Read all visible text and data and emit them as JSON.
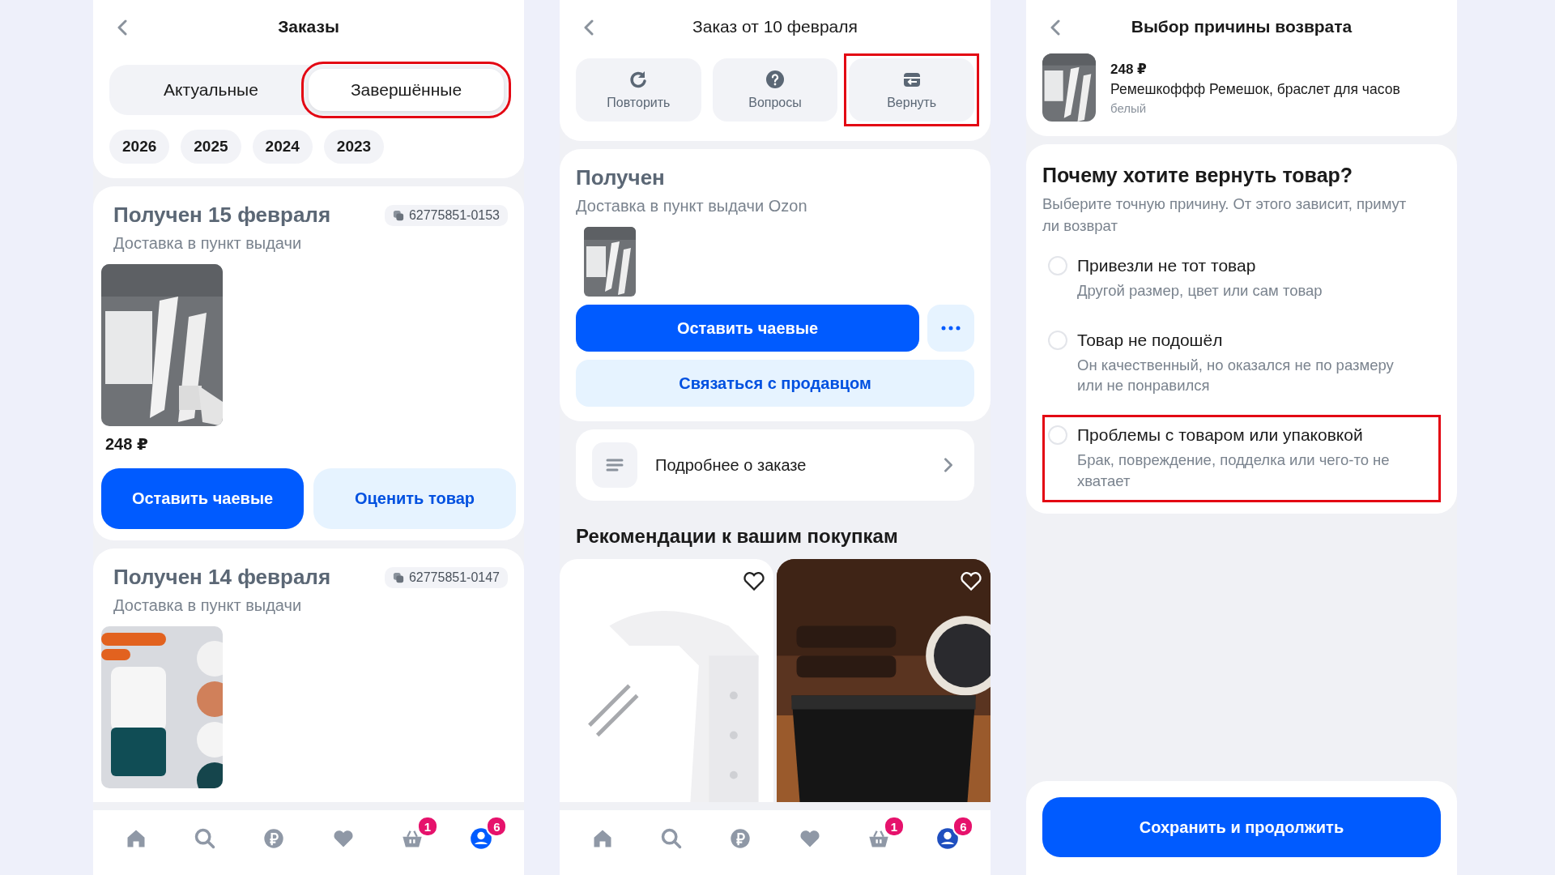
{
  "orders_screen": {
    "title": "Заказы",
    "tabs": [
      {
        "label": "Актуальные",
        "selected": false,
        "highlighted": false
      },
      {
        "label": "Завершённые",
        "selected": true,
        "highlighted": true
      }
    ],
    "years": [
      "2026",
      "2025",
      "2024",
      "2023"
    ],
    "orders": [
      {
        "title": "Получен 15 февраля",
        "number": "62775851-0153",
        "delivery": "Доставка в пункт выдачи",
        "price": "248 ₽",
        "buttons": [
          {
            "label": "Оставить чаевые",
            "kind": "primary"
          },
          {
            "label": "Оценить товар",
            "kind": "secondary"
          }
        ]
      },
      {
        "title": "Получен 14 февраля",
        "number": "62775851-0147",
        "delivery": "Доставка в пункт выдачи"
      }
    ],
    "nav": [
      {
        "selected": false
      },
      {
        "selected": false
      },
      {
        "selected": false
      },
      {
        "selected": false
      },
      {
        "selected": false,
        "badge": "1"
      },
      {
        "selected": true,
        "badge": "6"
      }
    ]
  },
  "order_screen": {
    "title": "Заказ от 10 февраля",
    "actions": [
      {
        "label": "Повторить",
        "highlighted": false
      },
      {
        "label": "Вопросы",
        "highlighted": false
      },
      {
        "label": "Вернуть",
        "highlighted": true
      }
    ],
    "status": "Получен",
    "delivery": "Доставка в пункт выдачи Ozon",
    "tip_button": "Оставить чаевые",
    "contact_button": "Связаться с продавцом",
    "details": "Подробнее о заказе",
    "recommendations_title": "Рекомендации к вашим покупкам",
    "nav": [
      {
        "selected": false
      },
      {
        "selected": false
      },
      {
        "selected": false
      },
      {
        "selected": false
      },
      {
        "selected": false,
        "badge": "1"
      },
      {
        "selected": true,
        "badge": "6"
      }
    ]
  },
  "return_screen": {
    "title": "Выбор причины возврата",
    "product": {
      "price": "248 ₽",
      "name": "Ремешкоффф Ремешок, браслет для часов",
      "variant": "белый"
    },
    "question": "Почему хотите вернуть товар?",
    "hint": "Выберите точную причину. От этого зависит, примут ли возврат",
    "reasons": [
      {
        "title": "Привезли не тот товар",
        "description": "Другой размер, цвет или сам товар",
        "selected": false,
        "highlighted": false
      },
      {
        "title": "Товар не подошёл",
        "description": "Он качественный, но оказался не по размеру или не понравился",
        "selected": false,
        "highlighted": false
      },
      {
        "title": "Проблемы с товаром или упаковкой",
        "description": "Брак, повреждение, подделка или чего-то не хватает",
        "selected": false,
        "highlighted": true
      }
    ],
    "submit": "Сохранить и продолжить"
  }
}
